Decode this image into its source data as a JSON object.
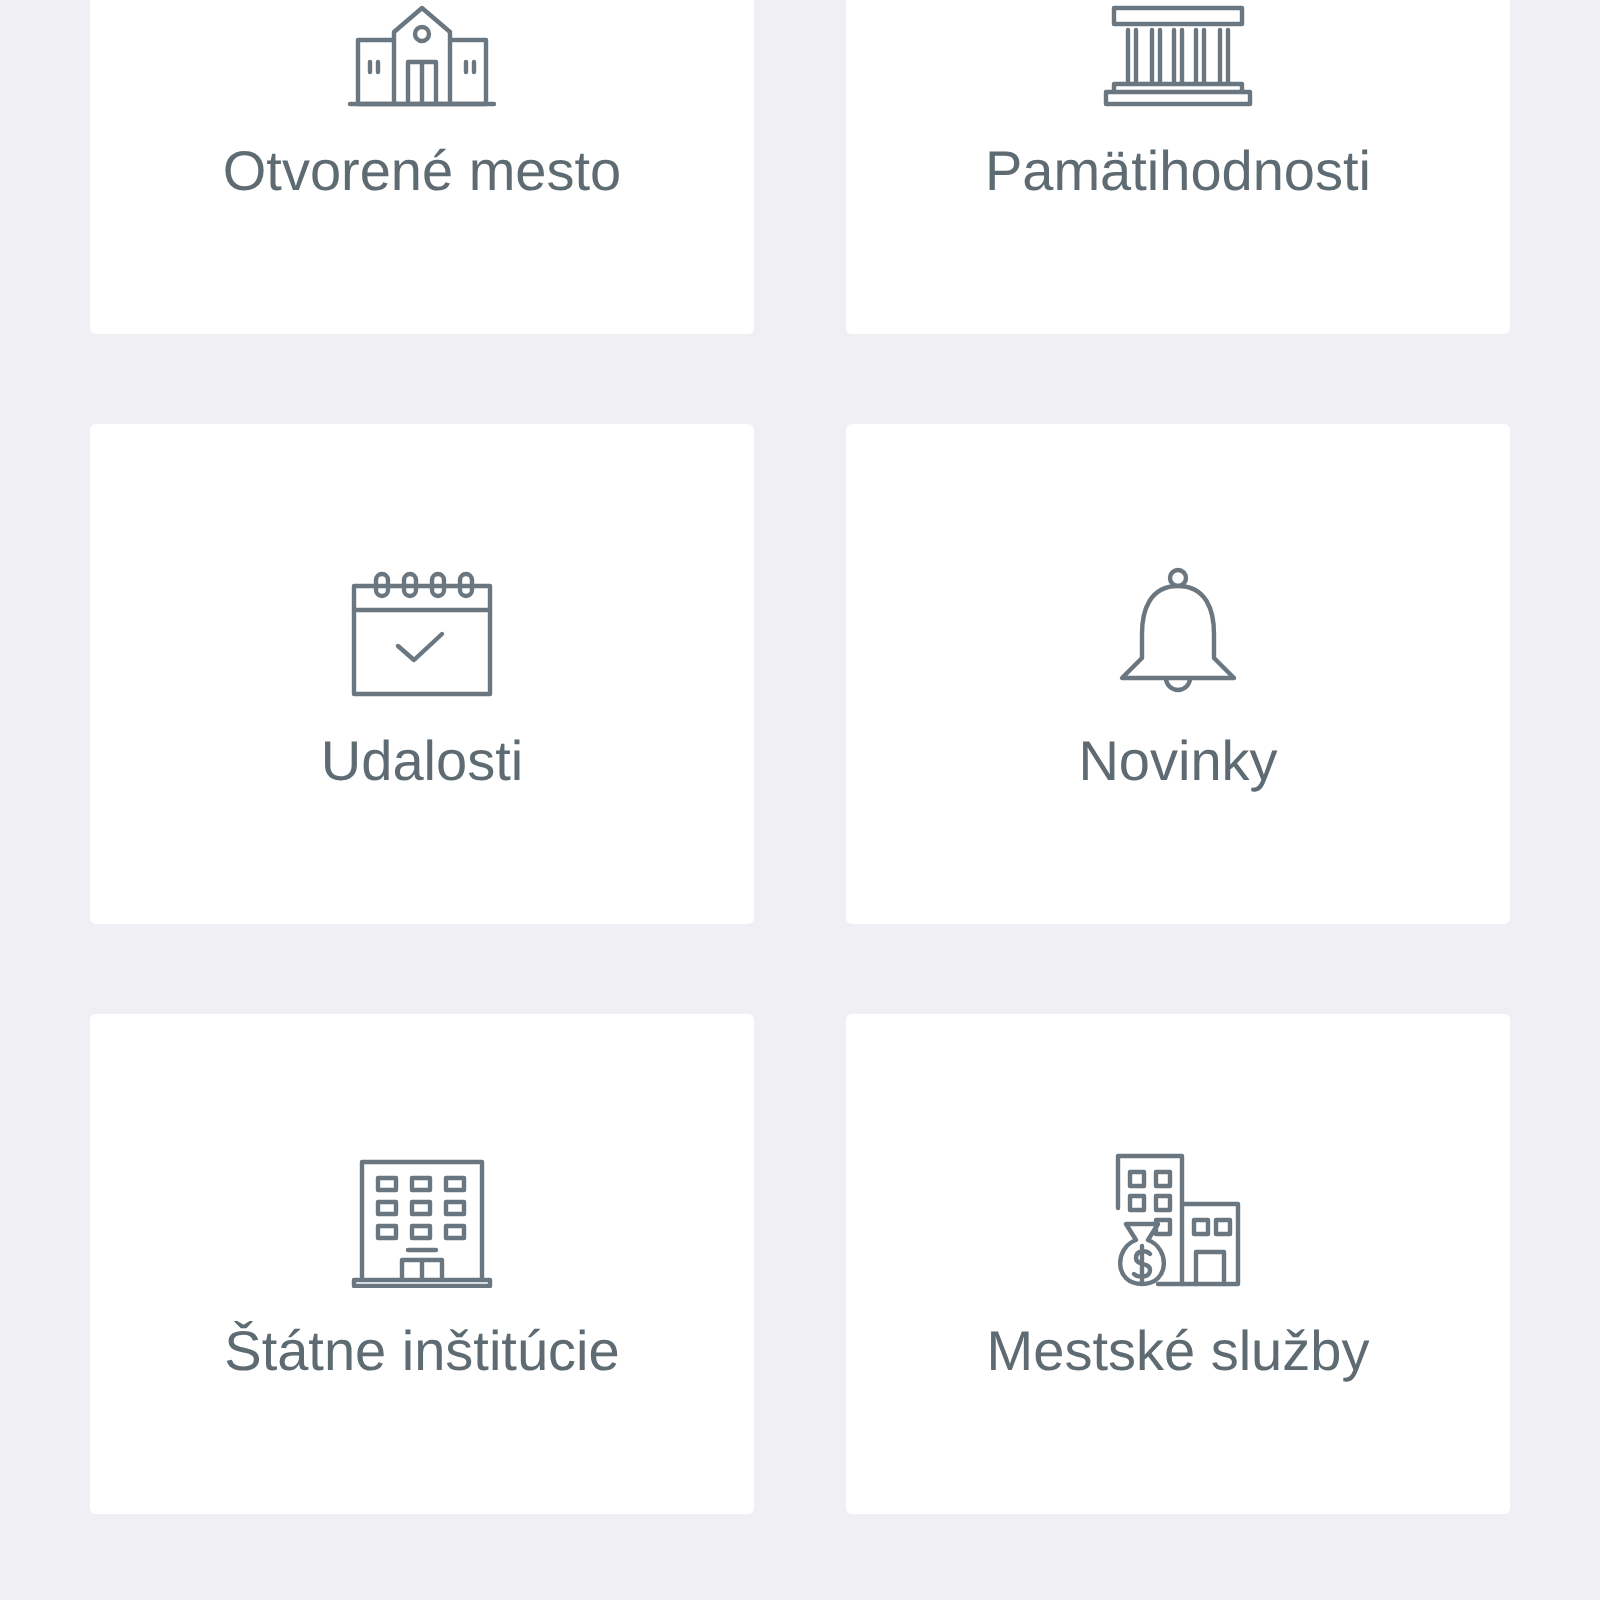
{
  "tiles": [
    {
      "kind": "townhall",
      "label": "Otvorené mesto"
    },
    {
      "kind": "monument",
      "label": "Pamätihodnosti"
    },
    {
      "kind": "calendar",
      "label": "Udalosti"
    },
    {
      "kind": "bell",
      "label": "Novinky"
    },
    {
      "kind": "office",
      "label": "Štátne inštitúcie"
    },
    {
      "kind": "services",
      "label": "Mestské služby"
    }
  ]
}
